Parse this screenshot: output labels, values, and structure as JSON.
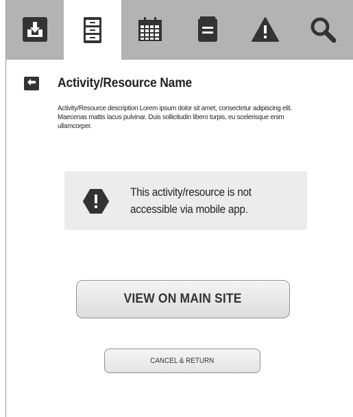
{
  "tabs": [
    {
      "icon": "download-icon",
      "active": false
    },
    {
      "icon": "filing-cabinet-icon",
      "active": true
    },
    {
      "icon": "calendar-icon",
      "active": false
    },
    {
      "icon": "notepad-icon",
      "active": false
    },
    {
      "icon": "warning-icon",
      "active": false
    },
    {
      "icon": "search-icon",
      "active": false
    }
  ],
  "header": {
    "back_icon": "back-arrow-icon",
    "title": "Activity/Resource Name"
  },
  "description": "Activity/Resource description Lorem ipsum dolor sit amet, consectetur adipiscing elit. Maecenas mattis lacus pulvinar. Duis sollicitudin libero turpis, eu scelerisque enim ullamcorper.",
  "notice": {
    "icon": "alert-octagon-icon",
    "text": "This activity/resource is not accessible via mobile app."
  },
  "actions": {
    "primary_label": "VIEW ON MAIN SITE",
    "secondary_label": "CANCEL & RETURN"
  },
  "colors": {
    "tabbar": "#b3b3b3",
    "active_tab": "#ffffff",
    "icon_dark": "#333333",
    "notice_bg": "#ececec"
  }
}
